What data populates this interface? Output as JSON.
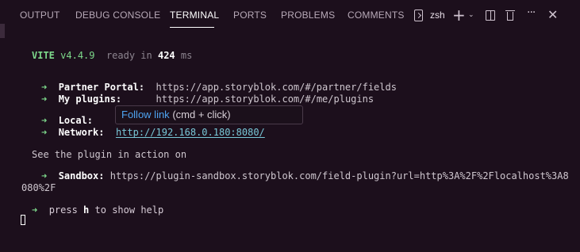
{
  "panel_tabs": [
    {
      "label": "OUTPUT"
    },
    {
      "label": "DEBUG CONSOLE"
    },
    {
      "label": "TERMINAL"
    },
    {
      "label": "PORTS"
    },
    {
      "label": "PROBLEMS"
    },
    {
      "label": "COMMENTS"
    }
  ],
  "active_tab": "TERMINAL",
  "toolbar": {
    "shell_label": "zsh",
    "icons": [
      "terminal-shell-icon",
      "add-icon",
      "chevron-down-icon",
      "split-terminal-icon",
      "trash-icon",
      "more-icon",
      "close-icon"
    ]
  },
  "terminal": {
    "vite_name": "VITE",
    "vite_version": "v4.4.9",
    "ready_prefix": "ready in",
    "ready_time": "424",
    "ready_unit": "ms",
    "arrow": "➜",
    "partner_portal_label": "Partner Portal:",
    "partner_portal_url": "https://app.storyblok.com/#/partner/fields",
    "my_plugins_label": "My plugins:",
    "my_plugins_url": "https://app.storyblok.com/#/me/plugins",
    "local_label": "Local:",
    "network_label": "Network:",
    "network_url": "http://192.168.0.180:8080/",
    "see_plugin_text": "See the plugin in action on",
    "sandbox_label": "Sandbox:",
    "sandbox_url_line1": "https://plugin-sandbox.storyblok.com/field-plugin?url=http%3A%2F%2Flocalhost%3A8",
    "sandbox_url_line2": "080%2F",
    "help_prefix": "press",
    "help_key": "h",
    "help_suffix": "to show help"
  },
  "tooltip": {
    "link_text": "Follow link",
    "hint_text": "(cmd + click)"
  },
  "colors": {
    "background": "#1c0f1c",
    "green": "#7dd88b",
    "cyan": "#79c8d8",
    "link_blue": "#4ea3f0"
  }
}
